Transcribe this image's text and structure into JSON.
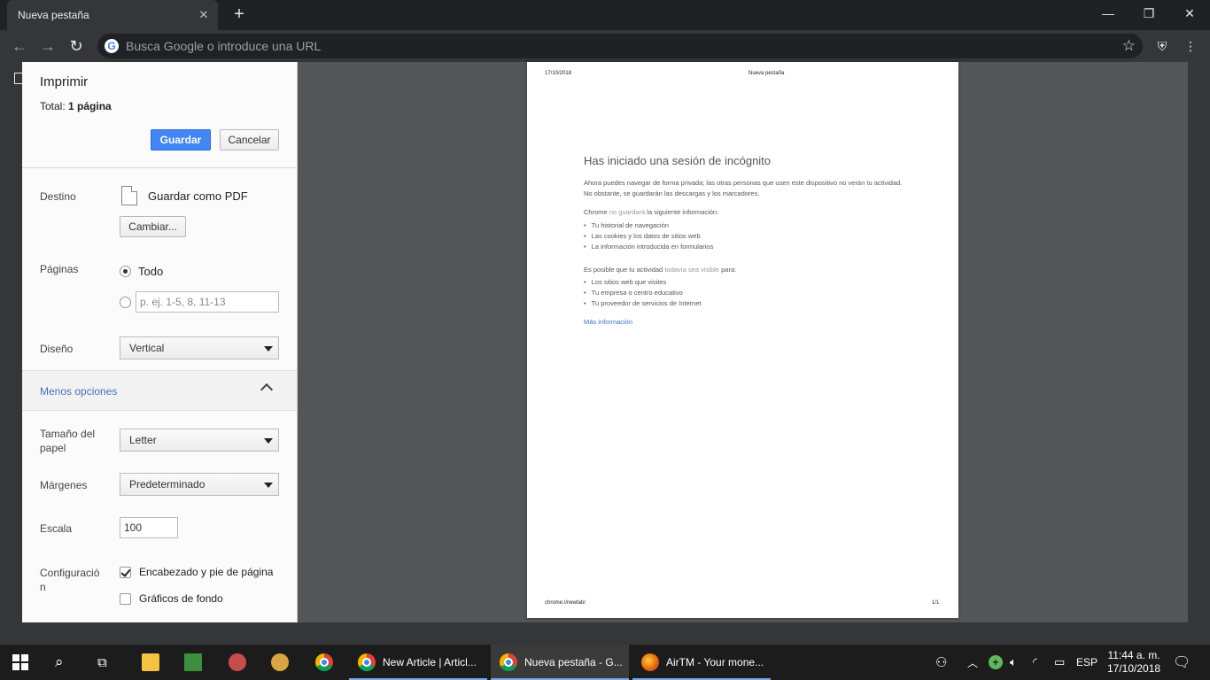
{
  "browser": {
    "tab_title": "Nueva pestaña",
    "omnibox_placeholder": "Busca Google o introduce una URL"
  },
  "print": {
    "title": "Imprimir",
    "total_prefix": "Total: ",
    "total_value": "1 página",
    "save_button": "Guardar",
    "cancel_button": "Cancelar",
    "destination_label": "Destino",
    "destination_value": "Guardar como PDF",
    "change_button": "Cambiar...",
    "pages_label": "Páginas",
    "pages_all": "Todo",
    "pages_custom_placeholder": "p. ej. 1-5, 8, 11-13",
    "layout_label": "Diseño",
    "layout_value": "Vertical",
    "less_options": "Menos opciones",
    "paper_label": "Tamaño del papel",
    "paper_value": "Letter",
    "margins_label": "Márgenes",
    "margins_value": "Predeterminado",
    "scale_label": "Escala",
    "scale_value": "100",
    "settings_label": "Configuración",
    "header_footer": "Encabezado y pie de página",
    "background_graphics": "Gráficos de fondo"
  },
  "preview": {
    "header_date": "17/10/2018",
    "header_title": "Nueva pestaña",
    "heading": "Has iniciado una sesión de incógnito",
    "intro": "Ahora puedes navegar de forma privada; las otras personas que usen este dispositivo no verán tu actividad. No obstante, se guardarán las descargas y los marcadores.",
    "chrome_prefix": "Chrome ",
    "chrome_muted": "no guardará",
    "chrome_suffix": " la siguiente información:",
    "not_saved": [
      "Tu historial de navegación",
      "Las cookies y los datos de sitios web",
      "La información introducida en formularios"
    ],
    "visible_prefix": "Es posible que tu actividad ",
    "visible_muted": "todavía sea visible",
    "visible_suffix": " para:",
    "visible_to": [
      "Los sitios web que visites",
      "Tu empresa o centro educativo",
      "Tu proveedor de servicios de Internet"
    ],
    "more_info": "Más información",
    "footer_url": "chrome://newtab/",
    "footer_page": "1/1"
  },
  "taskbar": {
    "items": [
      {
        "label": "New Article | Articl..."
      },
      {
        "label": "Nueva pestaña - G..."
      },
      {
        "label": "AirTM - Your mone..."
      }
    ],
    "language": "ESP",
    "time": "11:44 a. m.",
    "date": "17/10/2018"
  }
}
